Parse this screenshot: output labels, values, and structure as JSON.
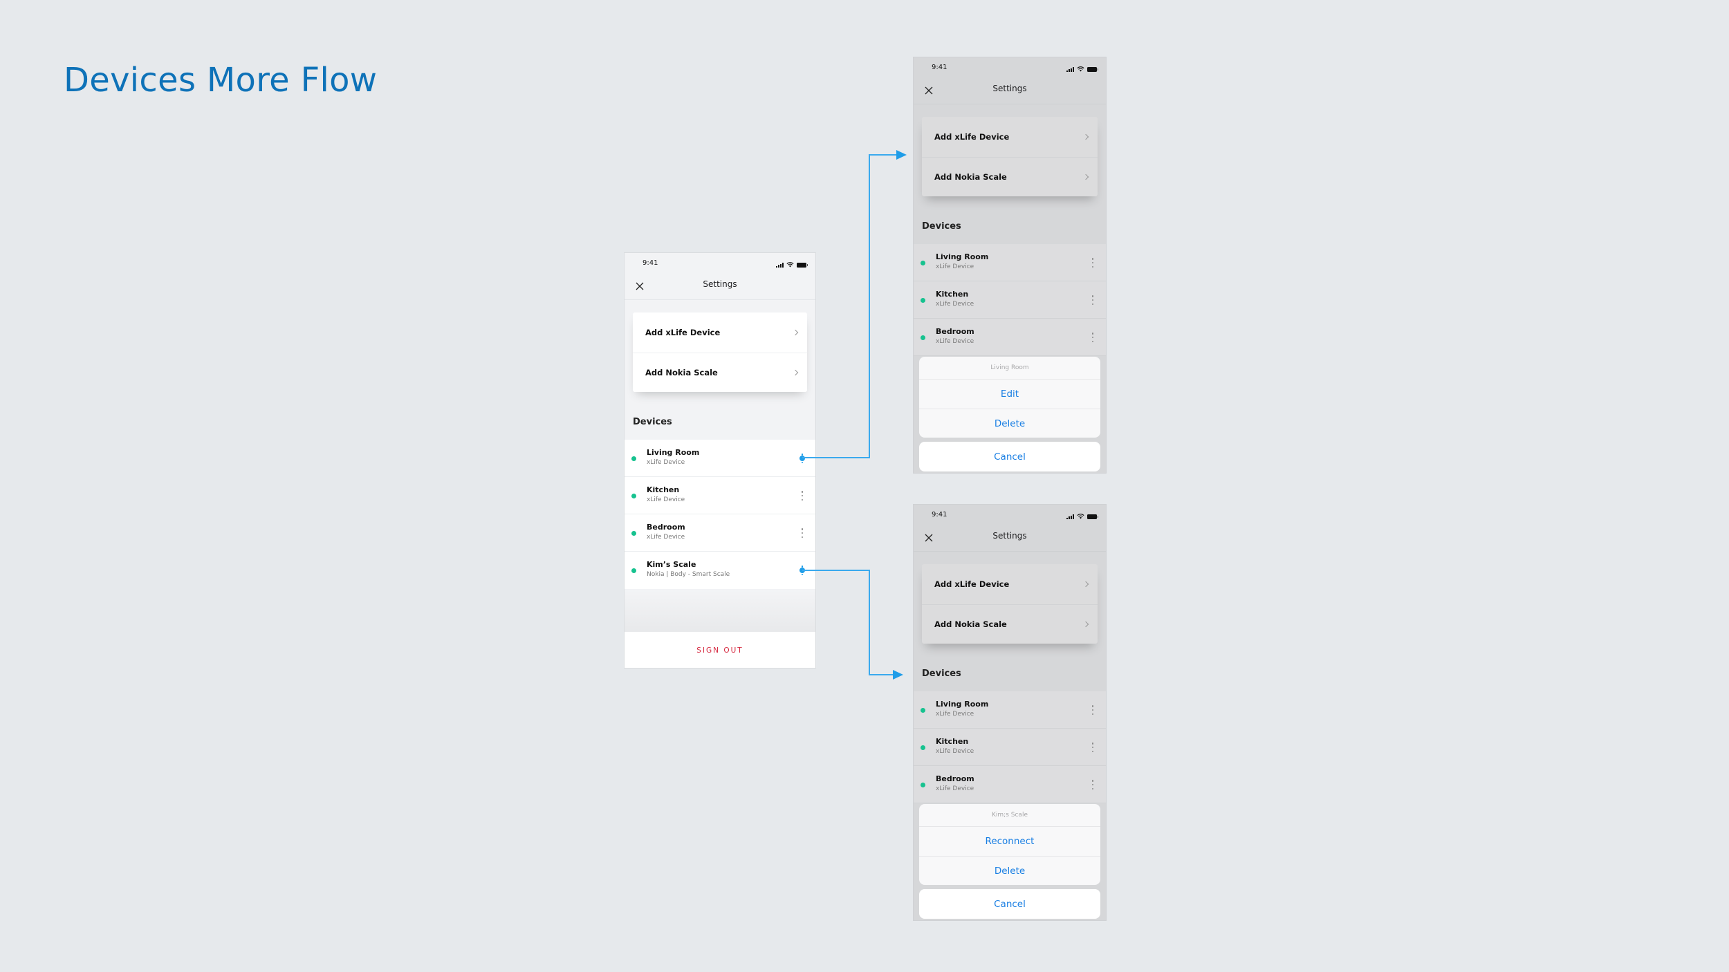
{
  "page": {
    "title": "Devices More Flow",
    "accent_color": "#0e72b8",
    "connector_color": "#1f9de8"
  },
  "main_screen": {
    "status_time": "9:41",
    "nav_title": "Settings",
    "add_items": [
      {
        "label": "Add xLife Device"
      },
      {
        "label": "Add Nokia Scale"
      }
    ],
    "section_label": "Devices",
    "devices": [
      {
        "name": "Living Room",
        "type": "xLife Device",
        "status": "online"
      },
      {
        "name": "Kitchen",
        "type": "xLife Device",
        "status": "online"
      },
      {
        "name": "Bedroom",
        "type": "xLife Device",
        "status": "online"
      },
      {
        "name": "Kim’s Scale",
        "type": "Nokia | Body - Smart Scale",
        "status": "online"
      }
    ],
    "sign_out_label": "SIGN OUT",
    "status_color": "#16c28f",
    "sign_out_color": "#d6283f"
  },
  "device_sheet": {
    "status_time": "9:41",
    "nav_title": "Settings",
    "add_items": [
      {
        "label": "Add xLife Device"
      },
      {
        "label": "Add Nokia Scale"
      }
    ],
    "section_label": "Devices",
    "devices": [
      {
        "name": "Living Room",
        "type": "xLife Device"
      },
      {
        "name": "Kitchen",
        "type": "xLife Device"
      },
      {
        "name": "Bedroom",
        "type": "xLife Device"
      }
    ],
    "sheet_title": "Living Room",
    "actions": [
      "Edit",
      "Delete"
    ],
    "cancel_label": "Cancel"
  },
  "scale_sheet": {
    "status_time": "9:41",
    "nav_title": "Settings",
    "add_items": [
      {
        "label": "Add xLife Device"
      },
      {
        "label": "Add Nokia Scale"
      }
    ],
    "section_label": "Devices",
    "devices": [
      {
        "name": "Living Room",
        "type": "xLife Device"
      },
      {
        "name": "Kitchen",
        "type": "xLife Device"
      },
      {
        "name": "Bedroom",
        "type": "xLife Device"
      }
    ],
    "sheet_title": "Kim;s Scale",
    "actions": [
      "Reconnect",
      "Delete"
    ],
    "cancel_label": "Cancel"
  },
  "flows": [
    {
      "from": "Living Room more button",
      "to": "Living Room action sheet screen"
    },
    {
      "from": "Kim’s Scale more button",
      "to": "Kim;s Scale action sheet screen"
    }
  ]
}
